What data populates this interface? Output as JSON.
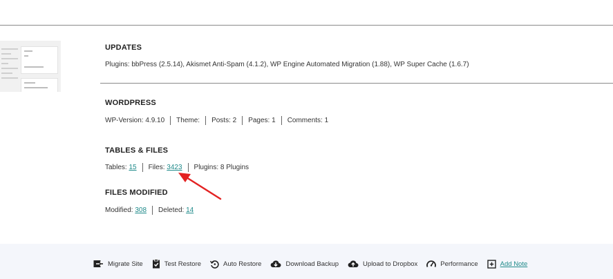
{
  "updates": {
    "title": "UPDATES",
    "plugins_text": "Plugins: bbPress (2.5.14), Akismet Anti-Spam (4.1.2), WP Engine Automated Migration (1.88), WP Super Cache (1.6.7)"
  },
  "wordpress": {
    "title": "WORDPRESS",
    "wp_version": "WP-Version: 4.9.10",
    "theme": "Theme:",
    "posts": "Posts: 2",
    "pages": "Pages: 1",
    "comments": "Comments: 1"
  },
  "tables_files": {
    "title": "TABLES & FILES",
    "tables_label": "Tables:",
    "tables_value": "15",
    "files_label": "Files:",
    "files_value": "3423",
    "plugins": "Plugins: 8 Plugins"
  },
  "files_modified": {
    "title": "FILES MODIFIED",
    "modified_label": "Modified:",
    "modified_value": "308",
    "deleted_label": "Deleted:",
    "deleted_value": "14"
  },
  "footer": {
    "migrate": "Migrate Site",
    "test_restore": "Test Restore",
    "auto_restore": "Auto Restore",
    "download_backup": "Download Backup",
    "upload_dropbox": "Upload to Dropbox",
    "performance": "Performance",
    "add_note": "Add Note"
  },
  "colors": {
    "link": "#1f8a8a",
    "arrow": "#e32222",
    "footer_bg": "#f4f6fb"
  }
}
